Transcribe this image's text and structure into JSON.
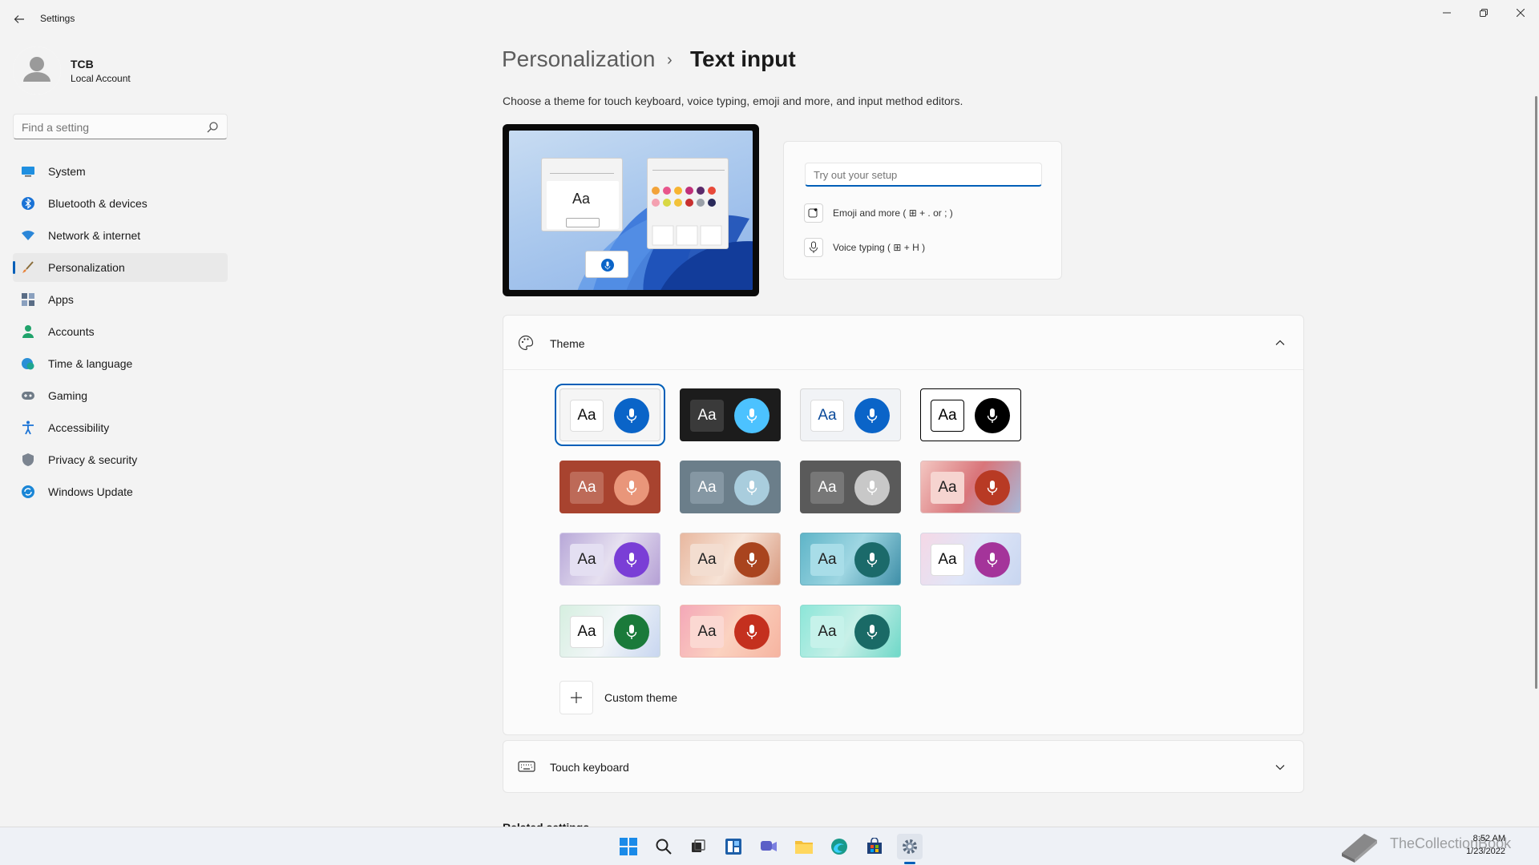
{
  "window": {
    "title": "Settings"
  },
  "profile": {
    "name": "TCB",
    "account_type": "Local Account"
  },
  "search": {
    "placeholder": "Find a setting"
  },
  "sidebar": {
    "items": [
      {
        "label": "System",
        "icon": "monitor-icon"
      },
      {
        "label": "Bluetooth & devices",
        "icon": "bluetooth-icon"
      },
      {
        "label": "Network & internet",
        "icon": "wifi-icon"
      },
      {
        "label": "Personalization",
        "icon": "brush-icon",
        "active": true
      },
      {
        "label": "Apps",
        "icon": "apps-icon"
      },
      {
        "label": "Accounts",
        "icon": "person-icon"
      },
      {
        "label": "Time & language",
        "icon": "globe-clock-icon"
      },
      {
        "label": "Gaming",
        "icon": "gamepad-icon"
      },
      {
        "label": "Accessibility",
        "icon": "accessibility-icon"
      },
      {
        "label": "Privacy & security",
        "icon": "shield-icon"
      },
      {
        "label": "Windows Update",
        "icon": "update-icon"
      }
    ]
  },
  "breadcrumb": {
    "parent": "Personalization",
    "separator": "›",
    "current": "Text input"
  },
  "description": "Choose a theme for touch keyboard, voice typing, emoji and more, and input method editors.",
  "preview": {
    "sample_text": "Aa"
  },
  "tryout": {
    "placeholder": "Try out your setup",
    "emoji_label": "Emoji and more ( ⊞ + . or ; )",
    "voice_label": "Voice typing ( ⊞ + H )"
  },
  "theme_section": {
    "label": "Theme",
    "sample_text": "Aa",
    "custom_label": "Custom theme",
    "themes": [
      {
        "bg": "#f5f5f5",
        "aa_bg": "#ffffff",
        "aa_fg": "#111111",
        "mic": "#0a64c8",
        "border": "#d8d8d8",
        "selected": true
      },
      {
        "bg": "#1c1c1c",
        "aa_bg": "#3a3a3a",
        "aa_fg": "#ffffff",
        "mic": "#4cc2ff",
        "border": "#1c1c1c"
      },
      {
        "bg": "#f1f3f6",
        "aa_bg": "#ffffff",
        "aa_fg": "#0a4a9a",
        "mic": "#0a64c8",
        "border": "#d8d8d8"
      },
      {
        "bg": "#ffffff",
        "aa_bg": "#ffffff",
        "aa_fg": "#000000",
        "mic": "#000000",
        "border": "#000000"
      },
      {
        "bg": "#a8432f",
        "aa_bg": "#bd6a58",
        "aa_fg": "#ffffff",
        "mic": "#e9967a",
        "border": "#a8432f"
      },
      {
        "bg": "#6b7e8a",
        "aa_bg": "#8597a3",
        "aa_fg": "#ffffff",
        "mic": "#a9cddd",
        "border": "#6b7e8a"
      },
      {
        "bg": "#5a5a5a",
        "aa_bg": "#777777",
        "aa_fg": "#ffffff",
        "mic": "#c8c8c8",
        "border": "#5a5a5a"
      },
      {
        "bg": "linear-gradient(120deg,#f3c6c1,#d9757a,#a8b8d8)",
        "aa_bg": "#f6d4d0",
        "aa_fg": "#222222",
        "mic": "#b83a24",
        "border": "#e0c0c0"
      },
      {
        "bg": "linear-gradient(120deg,#b8a8d8,#e6e0f0,#b5a0d5)",
        "aa_bg": "#e4dff2",
        "aa_fg": "#222222",
        "mic": "#7a3ed6",
        "border": "#d0c8e6"
      },
      {
        "bg": "linear-gradient(120deg,#e8b8a0,#f7e3d6,#d89a80)",
        "aa_bg": "#f3ddd0",
        "aa_fg": "#222222",
        "mic": "#a9441e",
        "border": "#e0c8bc"
      },
      {
        "bg": "linear-gradient(120deg,#5fb5c8,#9ed6e2,#3f8fa8)",
        "aa_bg": "#a8dde8",
        "aa_fg": "#222222",
        "mic": "#1b6a6a",
        "border": "#6ab0c0"
      },
      {
        "bg": "linear-gradient(120deg,#f5d8e6,#e0e6f8,#c8d6f0)",
        "aa_bg": "#ffffff",
        "aa_fg": "#111111",
        "mic": "#a4349a",
        "border": "#d8d8e6"
      },
      {
        "bg": "linear-gradient(120deg,#d6efe0,#f2f6f8,#c8d6f0)",
        "aa_bg": "#ffffff",
        "aa_fg": "#111111",
        "mic": "#1a7a3a",
        "border": "#d0dcd8"
      },
      {
        "bg": "linear-gradient(120deg,#f4a8b8,#fbd2c0,#f6b4a0)",
        "aa_bg": "#fbd8d2",
        "aa_fg": "#222222",
        "mic": "#c4301e",
        "border": "#f0b8b0"
      },
      {
        "bg": "linear-gradient(120deg,#8ce6d8,#c8f0e8,#6fd8c8)",
        "aa_bg": "#c6f2ea",
        "aa_fg": "#222222",
        "mic": "#1a6a66",
        "border": "#90dcd0"
      }
    ]
  },
  "touch_keyboard": {
    "label": "Touch keyboard"
  },
  "related_settings": {
    "label": "Related settings"
  },
  "taskbar": {
    "icons": [
      "windows-start-icon",
      "search-icon",
      "task-view-icon",
      "widgets-icon",
      "chat-icon",
      "file-explorer-icon",
      "edge-icon",
      "store-icon",
      "settings-icon"
    ],
    "time": "8:52 AM",
    "date": "1/23/2022"
  },
  "watermark": "TheCollectionBook",
  "colors": {
    "accent": "#005fb8",
    "background": "#f3f3f3",
    "card": "#fbfbfb"
  }
}
